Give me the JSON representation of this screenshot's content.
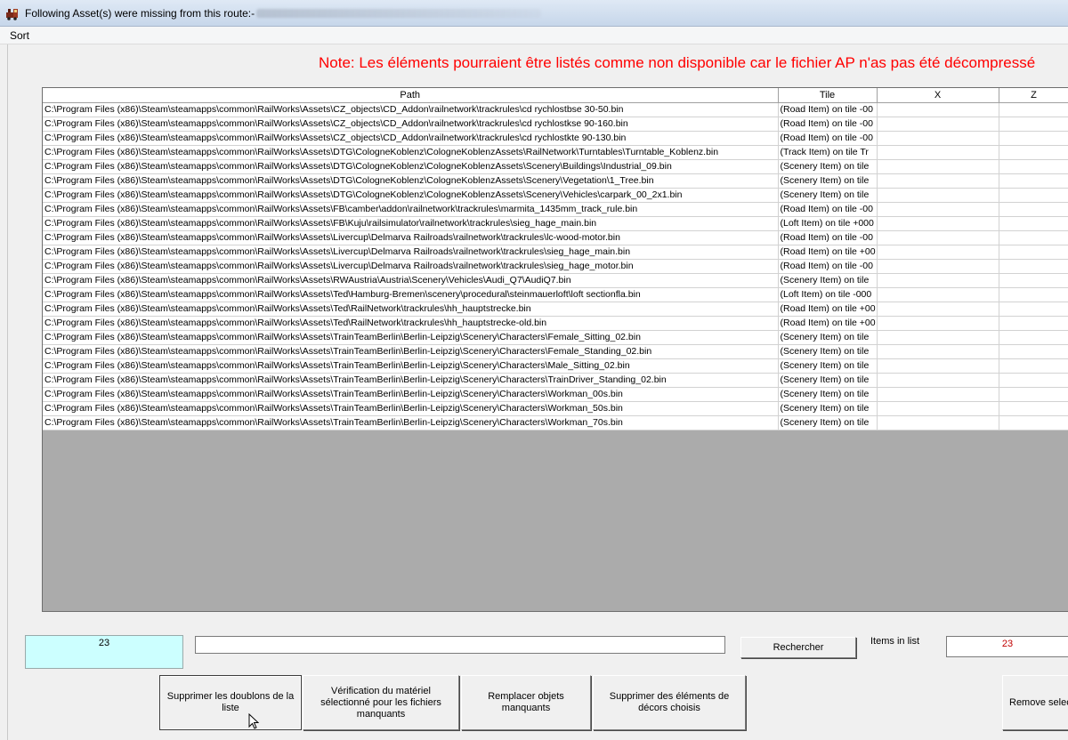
{
  "window": {
    "title": "Following Asset(s) were missing from this route:-"
  },
  "menu": {
    "items": [
      "Sort"
    ]
  },
  "note": "Note: Les éléments pourraient être listés comme non disponible car le fichier AP n'as pas été décompressé",
  "table": {
    "columns": [
      "Path",
      "Tile",
      "X",
      "Z"
    ],
    "rows": [
      [
        "C:\\Program Files (x86)\\Steam\\steamapps\\common\\RailWorks\\Assets\\CZ_objects\\CD_Addon\\railnetwork\\trackrules\\cd rychlostbse 30-50.bin",
        "(Road Item) on tile -00",
        "",
        ""
      ],
      [
        "C:\\Program Files (x86)\\Steam\\steamapps\\common\\RailWorks\\Assets\\CZ_objects\\CD_Addon\\railnetwork\\trackrules\\cd rychlostkse 90-160.bin",
        "(Road Item) on tile -00",
        "",
        ""
      ],
      [
        "C:\\Program Files (x86)\\Steam\\steamapps\\common\\RailWorks\\Assets\\CZ_objects\\CD_Addon\\railnetwork\\trackrules\\cd rychlostkte 90-130.bin",
        "(Road Item) on tile -00",
        "",
        ""
      ],
      [
        "C:\\Program Files (x86)\\Steam\\steamapps\\common\\RailWorks\\Assets\\DTG\\CologneKoblenz\\CologneKoblenzAssets\\RailNetwork\\Turntables\\Turntable_Koblenz.bin",
        "(Track Item) on tile Tr",
        "",
        ""
      ],
      [
        "C:\\Program Files (x86)\\Steam\\steamapps\\common\\RailWorks\\Assets\\DTG\\CologneKoblenz\\CologneKoblenzAssets\\Scenery\\Buildings\\Industrial_09.bin",
        "(Scenery Item) on tile",
        "",
        ""
      ],
      [
        "C:\\Program Files (x86)\\Steam\\steamapps\\common\\RailWorks\\Assets\\DTG\\CologneKoblenz\\CologneKoblenzAssets\\Scenery\\Vegetation\\1_Tree.bin",
        "(Scenery Item) on tile",
        "",
        ""
      ],
      [
        "C:\\Program Files (x86)\\Steam\\steamapps\\common\\RailWorks\\Assets\\DTG\\CologneKoblenz\\CologneKoblenzAssets\\Scenery\\Vehicles\\carpark_00_2x1.bin",
        "(Scenery Item) on tile",
        "",
        ""
      ],
      [
        "C:\\Program Files (x86)\\Steam\\steamapps\\common\\RailWorks\\Assets\\FB\\camber\\addon\\railnetwork\\trackrules\\marmita_1435mm_track_rule.bin",
        "(Road Item) on tile -00",
        "",
        ""
      ],
      [
        "C:\\Program Files (x86)\\Steam\\steamapps\\common\\RailWorks\\Assets\\FB\\Kuju\\railsimulator\\railnetwork\\trackrules\\sieg_hage_main.bin",
        "(Loft Item) on tile +000",
        "",
        ""
      ],
      [
        "C:\\Program Files (x86)\\Steam\\steamapps\\common\\RailWorks\\Assets\\Livercup\\Delmarva Railroads\\railnetwork\\trackrules\\lc-wood-motor.bin",
        "(Road Item) on tile -00",
        "",
        ""
      ],
      [
        "C:\\Program Files (x86)\\Steam\\steamapps\\common\\RailWorks\\Assets\\Livercup\\Delmarva Railroads\\railnetwork\\trackrules\\sieg_hage_main.bin",
        "(Road Item) on tile +00",
        "",
        ""
      ],
      [
        "C:\\Program Files (x86)\\Steam\\steamapps\\common\\RailWorks\\Assets\\Livercup\\Delmarva Railroads\\railnetwork\\trackrules\\sieg_hage_motor.bin",
        "(Road Item) on tile -00",
        "",
        ""
      ],
      [
        "C:\\Program Files (x86)\\Steam\\steamapps\\common\\RailWorks\\Assets\\RWAustria\\Austria\\Scenery\\Vehicles\\Audi_Q7\\AudiQ7.bin",
        "(Scenery Item) on tile",
        "",
        ""
      ],
      [
        "C:\\Program Files (x86)\\Steam\\steamapps\\common\\RailWorks\\Assets\\Ted\\Hamburg-Bremen\\scenery\\procedural\\steinmauerloft\\loft sectionfla.bin",
        "(Loft Item) on tile -000",
        "",
        ""
      ],
      [
        "C:\\Program Files (x86)\\Steam\\steamapps\\common\\RailWorks\\Assets\\Ted\\RailNetwork\\trackrules\\hh_hauptstrecke.bin",
        "(Road Item) on tile +00",
        "",
        ""
      ],
      [
        "C:\\Program Files (x86)\\Steam\\steamapps\\common\\RailWorks\\Assets\\Ted\\RailNetwork\\trackrules\\hh_hauptstrecke-old.bin",
        "(Road Item) on tile +00",
        "",
        ""
      ],
      [
        "C:\\Program Files (x86)\\Steam\\steamapps\\common\\RailWorks\\Assets\\TrainTeamBerlin\\Berlin-Leipzig\\Scenery\\Characters\\Female_Sitting_02.bin",
        "(Scenery Item) on tile",
        "",
        ""
      ],
      [
        "C:\\Program Files (x86)\\Steam\\steamapps\\common\\RailWorks\\Assets\\TrainTeamBerlin\\Berlin-Leipzig\\Scenery\\Characters\\Female_Standing_02.bin",
        "(Scenery Item) on tile",
        "",
        ""
      ],
      [
        "C:\\Program Files (x86)\\Steam\\steamapps\\common\\RailWorks\\Assets\\TrainTeamBerlin\\Berlin-Leipzig\\Scenery\\Characters\\Male_Sitting_02.bin",
        "(Scenery Item) on tile",
        "",
        ""
      ],
      [
        "C:\\Program Files (x86)\\Steam\\steamapps\\common\\RailWorks\\Assets\\TrainTeamBerlin\\Berlin-Leipzig\\Scenery\\Characters\\TrainDriver_Standing_02.bin",
        "(Scenery Item) on tile",
        "",
        ""
      ],
      [
        "C:\\Program Files (x86)\\Steam\\steamapps\\common\\RailWorks\\Assets\\TrainTeamBerlin\\Berlin-Leipzig\\Scenery\\Characters\\Workman_00s.bin",
        "(Scenery Item) on tile",
        "",
        ""
      ],
      [
        "C:\\Program Files (x86)\\Steam\\steamapps\\common\\RailWorks\\Assets\\TrainTeamBerlin\\Berlin-Leipzig\\Scenery\\Characters\\Workman_50s.bin",
        "(Scenery Item) on tile",
        "",
        ""
      ],
      [
        "C:\\Program Files (x86)\\Steam\\steamapps\\common\\RailWorks\\Assets\\TrainTeamBerlin\\Berlin-Leipzig\\Scenery\\Characters\\Workman_70s.bin",
        "(Scenery Item) on tile",
        "",
        ""
      ]
    ]
  },
  "footer": {
    "selected_count": "23",
    "search_value": "",
    "search_button": "Rechercher",
    "items_label": "Items in list",
    "items_count": "23"
  },
  "actions": {
    "dedupe": "Supprimer les doublons de la liste",
    "verify": "Vérification du matériel sélectionné pour les fichiers manquants",
    "replace": "Remplacer objets manquants",
    "delete": "Supprimer des éléments de décors choisis",
    "remove": "Remove selected"
  },
  "colors": {
    "note": "#ff0000",
    "count_box_bg": "#ccffff",
    "items_count_text": "#c00000",
    "grid_empty_bg": "#ababab"
  },
  "icons": {
    "app": "train-icon",
    "cursor": "mouse-pointer-icon"
  }
}
